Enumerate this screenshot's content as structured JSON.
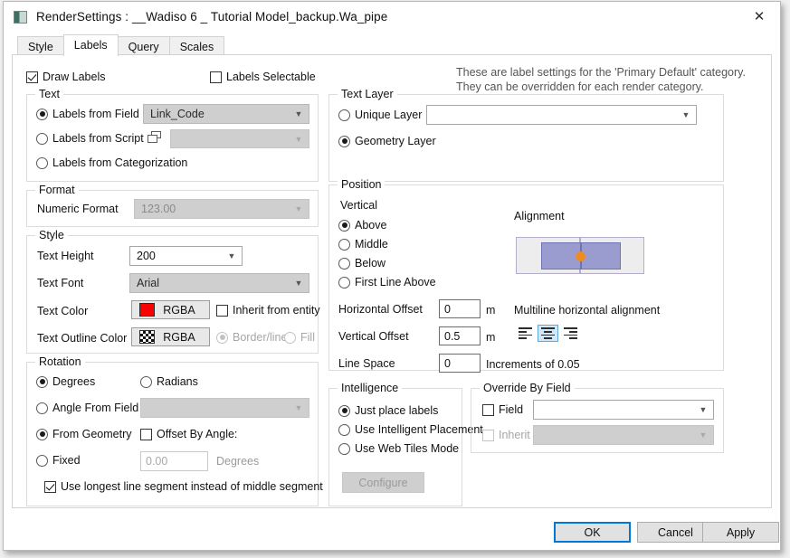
{
  "window": {
    "title": "RenderSettings : __Wadiso 6 _ Tutorial Model_backup.Wa_pipe",
    "close_label": "✕",
    "app_icon": "app-window-icon"
  },
  "tabs": [
    {
      "label": "Style",
      "active": false
    },
    {
      "label": "Labels",
      "active": true
    },
    {
      "label": "Query",
      "active": false
    },
    {
      "label": "Scales",
      "active": false
    }
  ],
  "top": {
    "draw_labels": {
      "label": "Draw Labels",
      "checked": true
    },
    "labels_selectable": {
      "label": "Labels Selectable",
      "checked": false
    },
    "note_line1": "These are label settings for the 'Primary Default' category.",
    "note_line2": "They can be overridden for each render category."
  },
  "text_group": {
    "caption": "Text",
    "labels_from_field": {
      "label": "Labels from Field",
      "selected": true
    },
    "field_value": "Link_Code",
    "labels_from_script": {
      "label": "Labels from Script",
      "selected": false
    },
    "script_value": "",
    "labels_from_categorization": {
      "label": "Labels from Categorization",
      "selected": false
    }
  },
  "format_group": {
    "caption": "Format",
    "numeric_format_label": "Numeric Format",
    "numeric_format_value": "123.00"
  },
  "style_group": {
    "caption": "Style",
    "text_height_label": "Text Height",
    "text_height_value": "200",
    "text_font_label": "Text Font",
    "text_font_value": "Arial",
    "text_color_label": "Text Color",
    "text_color_button": "RGBA",
    "text_color_swatch": "#fb0000",
    "inherit_from_entity": {
      "label": "Inherit from entity",
      "checked": false
    },
    "text_outline_label": "Text Outline Color",
    "text_outline_button": "RGBA",
    "text_outline_swatch": "checkerboard-transparent",
    "border_line": {
      "label": "Border/line",
      "selected": true
    },
    "fill": {
      "label": "Fill",
      "selected": false
    }
  },
  "rotation_group": {
    "caption": "Rotation",
    "degrees": {
      "label": "Degrees",
      "selected": true
    },
    "radians": {
      "label": "Radians",
      "selected": false
    },
    "angle_from_field": {
      "label": "Angle From Field",
      "selected": false
    },
    "angle_field_value": "",
    "from_geometry": {
      "label": "From Geometry",
      "selected": true
    },
    "offset_by_angle": {
      "label": "Offset By Angle:",
      "checked": false
    },
    "fixed": {
      "label": "Fixed",
      "selected": false
    },
    "fixed_value": "0.00",
    "degrees_unit": "Degrees",
    "use_longest_segment": {
      "label": "Use longest line segment instead of middle segment",
      "checked": true
    }
  },
  "text_layer_group": {
    "caption": "Text Layer",
    "unique_layer": {
      "label": "Unique Layer",
      "selected": false
    },
    "unique_layer_value": "",
    "geometry_layer": {
      "label": "Geometry Layer",
      "selected": true
    }
  },
  "position_group": {
    "caption": "Position",
    "vertical_label": "Vertical",
    "above": {
      "label": "Above",
      "selected": true
    },
    "middle": {
      "label": "Middle",
      "selected": false
    },
    "below": {
      "label": "Below",
      "selected": false
    },
    "first_line_above": {
      "label": "First Line Above",
      "selected": false
    },
    "horizontal_offset_label": "Horizontal Offset",
    "horizontal_offset_value": "0",
    "horizontal_offset_unit": "m",
    "vertical_offset_label": "Vertical Offset",
    "vertical_offset_value": "0.5",
    "vertical_offset_unit": "m",
    "line_space_label": "Line Space",
    "line_space_value": "0",
    "line_space_unit": "Increments of 0.05",
    "alignment_label": "Alignment",
    "alignment_colors": {
      "cell": "#ededed",
      "block": "#9a9cd0",
      "anchor": "#ef8b23"
    },
    "multiline_label": "Multiline horizontal alignment",
    "multiline_options": [
      {
        "name": "align-left",
        "selected": false
      },
      {
        "name": "align-center",
        "selected": true
      },
      {
        "name": "align-right",
        "selected": false
      }
    ]
  },
  "intelligence_group": {
    "caption": "Intelligence",
    "just_place_labels": {
      "label": "Just place labels",
      "selected": true
    },
    "use_intelligent_placement": {
      "label": "Use Intelligent Placement",
      "selected": false
    },
    "use_web_tiles_mode": {
      "label": "Use Web Tiles Mode",
      "selected": false
    },
    "configure_button": "Configure"
  },
  "override_group": {
    "caption": "Override By Field",
    "field": {
      "label": "Field",
      "checked": false
    },
    "field_value": "",
    "inherit": {
      "label": "Inherit",
      "checked": false
    },
    "inherit_value": ""
  },
  "footer": {
    "ok": "OK",
    "cancel": "Cancel",
    "apply": "Apply"
  }
}
